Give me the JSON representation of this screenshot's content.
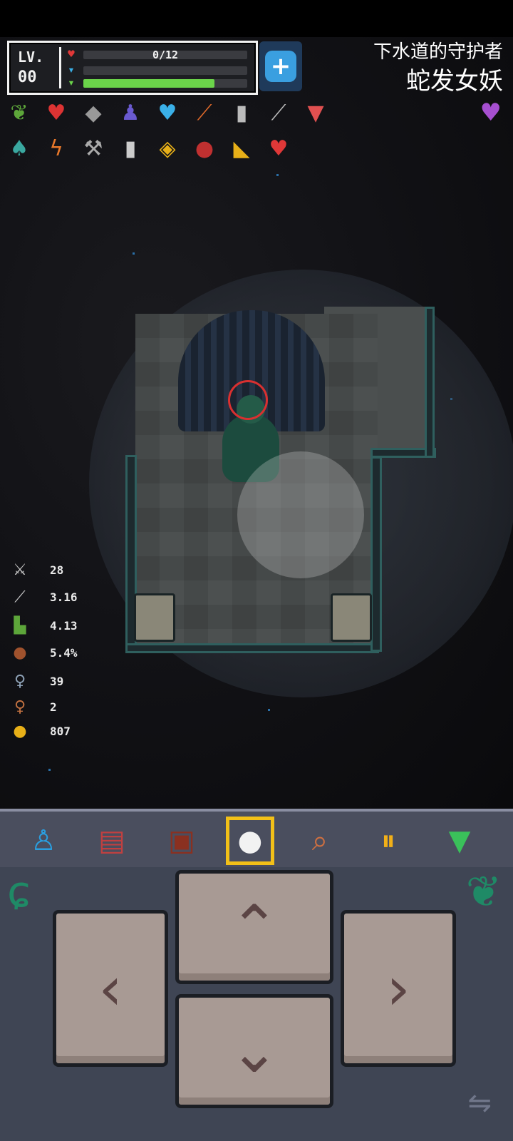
{
  "hud": {
    "level_label": "LV.",
    "level_value": "00",
    "hp_text": "0/12",
    "xp_fraction": 0.8,
    "heal_icon": "plus-icon"
  },
  "boss": {
    "subtitle": "下水道的守护者",
    "name": "蛇发女妖",
    "heart_icon": "purple-heart-icon"
  },
  "items_row1": [
    "leaf",
    "heart-piece",
    "stone",
    "figures",
    "blue-heart",
    "feather",
    "jar",
    "fork",
    "fangs"
  ],
  "items_row2": [
    "mushroom",
    "lightning",
    "axe",
    "jar",
    "diamond-tile",
    "red-seal",
    "cheese",
    "red-heart"
  ],
  "stats": [
    {
      "icon": "swords-icon",
      "value": "28"
    },
    {
      "icon": "blade-icon",
      "value": "3.16"
    },
    {
      "icon": "boot-icon",
      "value": "4.13"
    },
    {
      "icon": "shield-icon",
      "value": "5.4%"
    },
    {
      "icon": "silver-key-icon",
      "value": "39"
    },
    {
      "icon": "bronze-key-icon",
      "value": "2"
    },
    {
      "icon": "gold-coin-icon",
      "value": "807"
    }
  ],
  "toolbar": [
    {
      "name": "character-button",
      "icon": "person-icon"
    },
    {
      "name": "journal-button",
      "icon": "book-icon"
    },
    {
      "name": "inventory-button",
      "icon": "bag-icon"
    },
    {
      "name": "target-button",
      "icon": "target-icon",
      "selected": true
    },
    {
      "name": "search-button",
      "icon": "magnifier-icon"
    },
    {
      "name": "pause-button",
      "icon": "pause-icon"
    },
    {
      "name": "collapse-button",
      "icon": "down-arrow-icon"
    }
  ]
}
